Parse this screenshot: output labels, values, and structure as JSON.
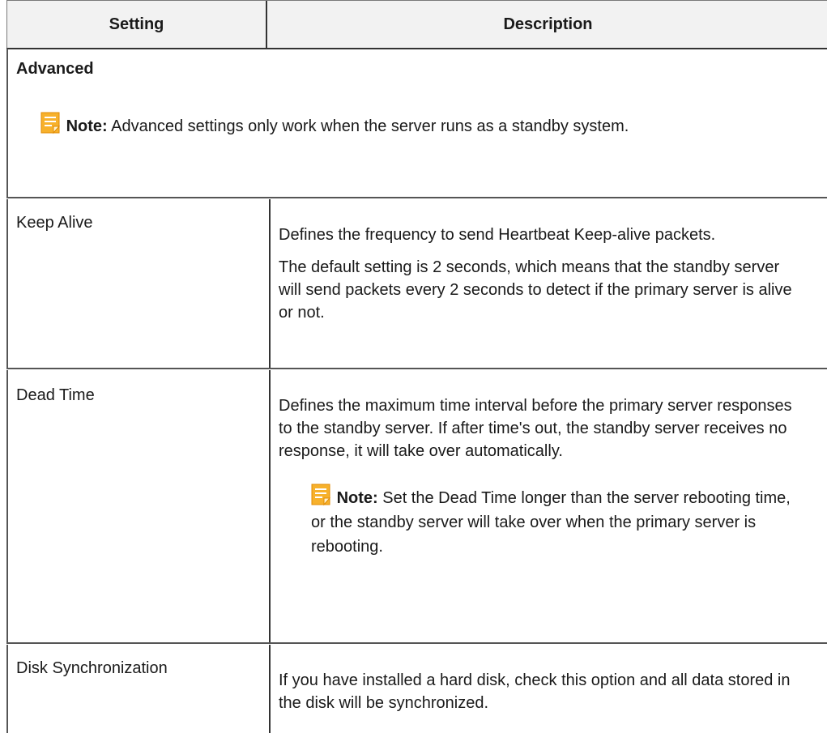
{
  "header": {
    "setting": "Setting",
    "description": "Description"
  },
  "section": {
    "title": "Advanced",
    "note_label": "Note:",
    "note_text": " Advanced settings only work when the server runs as a standby system."
  },
  "rows": [
    {
      "setting": "Keep Alive",
      "desc_p1": "Defines the frequency to send Heartbeat Keep-alive packets.",
      "desc_p2": "The default setting is 2 seconds, which means that the standby server will send packets every 2 seconds to detect if the primary server is alive or not."
    },
    {
      "setting": "Dead Time",
      "desc_p1": "Defines the maximum time interval before the primary server responses to the standby server. If after time's out, the standby server receives no response, it will take over automatically.",
      "note_label": "Note:",
      "note_text": " Set the Dead Time longer than the server rebooting time, or the standby server will take over when the primary server is rebooting."
    },
    {
      "setting": "Disk Synchronization",
      "desc_p1": "If you have installed a hard disk, check this option and all data stored in the disk will be synchronized."
    }
  ],
  "icons": {
    "note": "note-icon",
    "note_color": "#f5a623"
  }
}
